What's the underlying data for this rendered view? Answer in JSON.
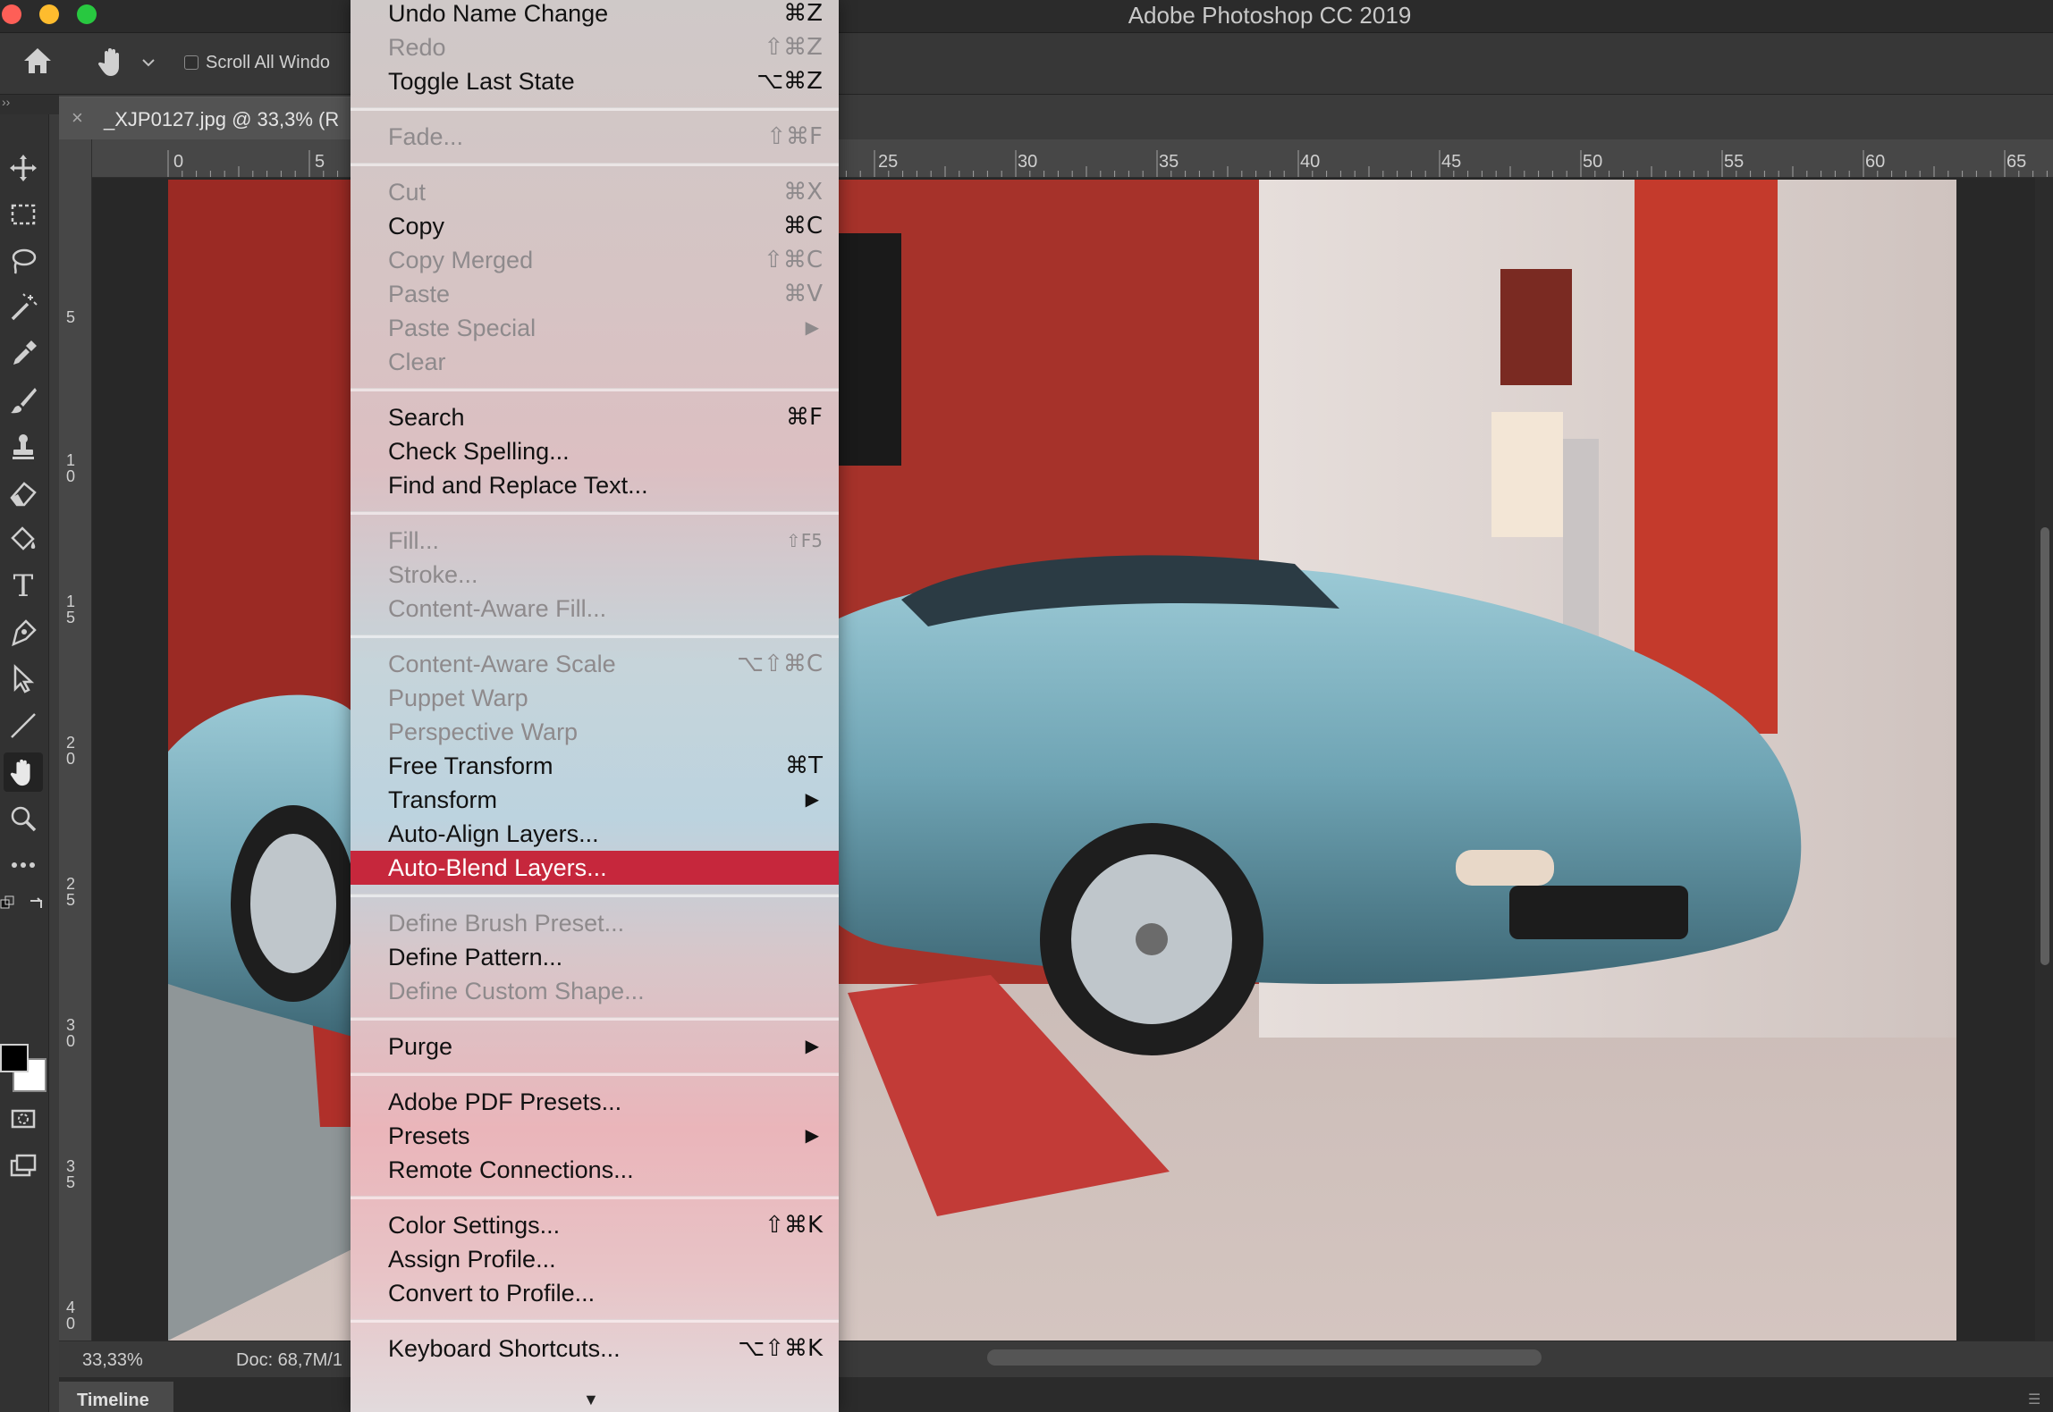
{
  "window": {
    "title": "Adobe Photoshop CC 2019"
  },
  "options_bar": {
    "scroll_all_windows": "Scroll All Windo"
  },
  "document": {
    "tab_title": "_XJP0127.jpg @ 33,3% (R",
    "zoom": "33,33%",
    "doc_size": "Doc: 68,7M/1",
    "ruler_top_labels": [
      "0",
      "5",
      "25",
      "30",
      "35",
      "40",
      "45",
      "50",
      "55",
      "60",
      "65"
    ],
    "ruler_left_labels": [
      [
        "5"
      ],
      [
        "1",
        "0"
      ],
      [
        "1",
        "5"
      ],
      [
        "2",
        "0"
      ],
      [
        "2",
        "5"
      ],
      [
        "3",
        "0"
      ],
      [
        "3",
        "5"
      ],
      [
        "4",
        "0"
      ]
    ]
  },
  "timeline": {
    "label": "Timeline"
  },
  "colors": {
    "highlight": "#c6273c",
    "foreground": "#000000",
    "background": "#ffffff"
  },
  "edit_menu": {
    "items": [
      {
        "label": "Undo Name Change",
        "shortcut": "⌘Z",
        "enabled": true
      },
      {
        "label": "Redo",
        "shortcut": "⇧⌘Z",
        "enabled": false
      },
      {
        "label": "Toggle Last State",
        "shortcut": "⌥⌘Z",
        "enabled": true
      },
      {
        "label": "Fade...",
        "shortcut": "⇧⌘F",
        "enabled": false
      },
      {
        "label": "Cut",
        "shortcut": "⌘X",
        "enabled": false
      },
      {
        "label": "Copy",
        "shortcut": "⌘C",
        "enabled": true
      },
      {
        "label": "Copy Merged",
        "shortcut": "⇧⌘C",
        "enabled": false
      },
      {
        "label": "Paste",
        "shortcut": "⌘V",
        "enabled": false
      },
      {
        "label": "Paste Special",
        "submenu": true,
        "enabled": false
      },
      {
        "label": "Clear",
        "enabled": false
      },
      {
        "label": "Search",
        "shortcut": "⌘F",
        "enabled": true
      },
      {
        "label": "Check Spelling...",
        "enabled": true
      },
      {
        "label": "Find and Replace Text...",
        "enabled": true
      },
      {
        "label": "Fill...",
        "shortcut": "⇧F5",
        "enabled": false
      },
      {
        "label": "Stroke...",
        "enabled": false
      },
      {
        "label": "Content-Aware Fill...",
        "enabled": false
      },
      {
        "label": "Content-Aware Scale",
        "shortcut": "⌥⇧⌘C",
        "enabled": false
      },
      {
        "label": "Puppet Warp",
        "enabled": false
      },
      {
        "label": "Perspective Warp",
        "enabled": false
      },
      {
        "label": "Free Transform",
        "shortcut": "⌘T",
        "enabled": true
      },
      {
        "label": "Transform",
        "submenu": true,
        "enabled": true
      },
      {
        "label": "Auto-Align Layers...",
        "enabled": true
      },
      {
        "label": "Auto-Blend Layers...",
        "enabled": true,
        "highlighted": true
      },
      {
        "label": "Define Brush Preset...",
        "enabled": false
      },
      {
        "label": "Define Pattern...",
        "enabled": true
      },
      {
        "label": "Define Custom Shape...",
        "enabled": false
      },
      {
        "label": "Purge",
        "submenu": true,
        "enabled": true
      },
      {
        "label": "Adobe PDF Presets...",
        "enabled": true
      },
      {
        "label": "Presets",
        "submenu": true,
        "enabled": true
      },
      {
        "label": "Remote Connections...",
        "enabled": true
      },
      {
        "label": "Color Settings...",
        "shortcut": "⇧⌘K",
        "enabled": true
      },
      {
        "label": "Assign Profile...",
        "enabled": true
      },
      {
        "label": "Convert to Profile...",
        "enabled": true
      },
      {
        "label": "Keyboard Shortcuts...",
        "shortcut": "⌥⇧⌘K",
        "enabled": true
      }
    ],
    "more_indicator": "▼"
  },
  "toolbar": {
    "tools": [
      "move-tool-icon",
      "marquee-tool-icon",
      "lasso-tool-icon",
      "magic-wand-tool-icon",
      "eyedropper-tool-icon",
      "brush-tool-icon",
      "stamp-tool-icon",
      "eraser-tool-icon",
      "paint-bucket-tool-icon",
      "type-tool-icon",
      "pen-tool-icon",
      "path-select-tool-icon",
      "line-tool-icon",
      "hand-tool-icon",
      "zoom-tool-icon",
      "more-tools-icon"
    ],
    "active": "hand-tool-icon",
    "type_glyph": "T"
  }
}
